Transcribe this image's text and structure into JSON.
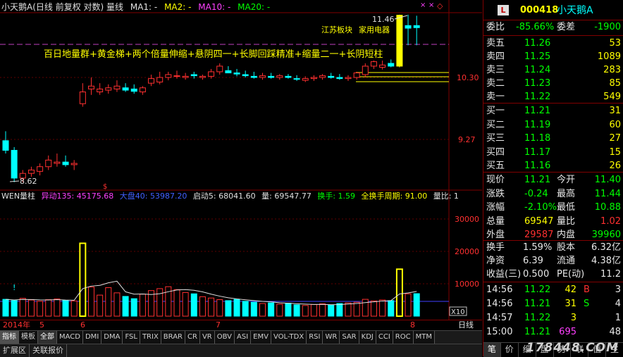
{
  "header": {
    "title": "小天鹅A(日线 前复权 对数) 量线",
    "ma1": "MA1: -",
    "ma2": "MA2: -",
    "ma10": "MA10: -",
    "ma20": "MA20: -"
  },
  "chart": {
    "high_label": "11.46",
    "low_label": "8.62",
    "sector1": "江苏板块",
    "sector2": "家用电器",
    "annotation": "百日地量群+黄金梯+两个倍量伸缩+悬阴四一+长脚回踩精准+缩量二一+长阴短柱",
    "price_axis": [
      "10.30",
      "9.27"
    ],
    "vol_axis": [
      "30000",
      "20000",
      "10000"
    ],
    "vol_unit": "X10",
    "event_mark": "$"
  },
  "volume_legend": {
    "name": "WEN量柱",
    "yidong": "异动135: 45175.68",
    "dapan": "大盘40: 53987.20",
    "qidong": "启动5: 68041.60",
    "liang": "量: 69547.77",
    "huanshou": "换手: 1.59",
    "quanhuanshou": "全换手周期: 91.00",
    "liangbi": "量比: 1"
  },
  "months": {
    "year": "2014年",
    "m5": "5",
    "m6": "6",
    "m7": "7",
    "m8": "8",
    "period": "日线"
  },
  "indicator_tabs": [
    "指标",
    "模板",
    "全部",
    "MACD",
    "DMI",
    "DMA",
    "FSL",
    "TRIX",
    "BRAR",
    "CR",
    "VR",
    "OBV",
    "ASI",
    "EMV",
    "VOL-TDX",
    "RSI",
    "WR",
    "SAR",
    "KDJ",
    "CCI",
    "ROC",
    "MTM"
  ],
  "bottom_tabs": [
    "扩展区",
    "关联报价"
  ],
  "quote": {
    "badge": "L",
    "code": "000418",
    "name": "小天鹅A",
    "weibi_label": "委比",
    "weibi_value": "-85.66%",
    "weicha_label": "委差",
    "weicha_value": "-1900",
    "asks": [
      {
        "label": "卖五",
        "price": "11.26",
        "vol": "53"
      },
      {
        "label": "卖四",
        "price": "11.25",
        "vol": "1089"
      },
      {
        "label": "卖三",
        "price": "11.24",
        "vol": "283"
      },
      {
        "label": "卖二",
        "price": "11.23",
        "vol": "85"
      },
      {
        "label": "卖一",
        "price": "11.22",
        "vol": "549"
      }
    ],
    "bids": [
      {
        "label": "买一",
        "price": "11.21",
        "vol": "31"
      },
      {
        "label": "买二",
        "price": "11.19",
        "vol": "60"
      },
      {
        "label": "买三",
        "price": "11.18",
        "vol": "27"
      },
      {
        "label": "买四",
        "price": "11.17",
        "vol": "15"
      },
      {
        "label": "买五",
        "price": "11.16",
        "vol": "26"
      }
    ],
    "stats": [
      {
        "l1": "现价",
        "v1": "11.21",
        "c1": "grn",
        "l2": "今开",
        "v2": "11.40",
        "c2": "grn"
      },
      {
        "l1": "涨跌",
        "v1": "-0.24",
        "c1": "grn",
        "l2": "最高",
        "v2": "11.44",
        "c2": "grn"
      },
      {
        "l1": "涨幅",
        "v1": "-2.10%",
        "c1": "grn",
        "l2": "最低",
        "v2": "10.88",
        "c2": "grn"
      },
      {
        "l1": "总量",
        "v1": "69547",
        "c1": "yel",
        "l2": "量比",
        "v2": "1.02",
        "c2": "red"
      },
      {
        "l1": "外盘",
        "v1": "29587",
        "c1": "red",
        "l2": "内盘",
        "v2": "39960",
        "c2": "grn"
      }
    ],
    "stats2": [
      {
        "l1": "换手",
        "v1": "1.59%",
        "l2": "股本",
        "v2": "6.32亿"
      },
      {
        "l1": "净资",
        "v1": "6.39",
        "l2": "流通",
        "v2": "4.38亿"
      },
      {
        "l1": "收益(三)",
        "v1": "0.500",
        "l2": "PE(动)",
        "v2": "11.2"
      }
    ],
    "ticks": [
      {
        "time": "14:56",
        "price": "11.22",
        "vol": "42",
        "dir": "B",
        "n": "3",
        "vc": "yel",
        "dc": "red"
      },
      {
        "time": "14:56",
        "price": "11.21",
        "vol": "31",
        "dir": "S",
        "n": "4",
        "vc": "yel",
        "dc": "grn"
      },
      {
        "time": "14:57",
        "price": "11.22",
        "vol": "3",
        "dir": "",
        "n": "1",
        "vc": "yel",
        "dc": "wht"
      },
      {
        "time": "15:00",
        "price": "11.21",
        "vol": "695",
        "dir": "",
        "n": "48",
        "vc": "mag",
        "dc": "wht"
      }
    ],
    "tabs": [
      "笔",
      "价",
      "细",
      "盘",
      "势",
      "联",
      "值",
      "主"
    ]
  },
  "watermark": "178448.COM",
  "chart_data": {
    "type": "candlestick",
    "x": [
      1,
      2,
      3,
      4,
      5,
      6,
      7,
      8,
      9,
      10,
      11,
      12,
      13,
      14,
      15,
      16,
      17,
      18,
      19,
      20,
      21,
      22,
      23,
      24,
      25,
      26,
      27,
      28,
      29,
      30,
      31,
      32,
      33,
      34,
      35,
      36,
      37,
      38,
      39,
      40,
      41,
      42,
      43,
      44,
      45,
      46,
      47,
      48,
      49
    ],
    "open": [
      9.25,
      9.1,
      8.68,
      8.75,
      8.78,
      8.85,
      8.9,
      8.92,
      8.88,
      9.85,
      10.1,
      10.05,
      10.08,
      10.1,
      10.12,
      10.1,
      10.05,
      10.2,
      10.22,
      10.3,
      10.32,
      10.3,
      10.35,
      10.3,
      10.32,
      10.4,
      10.42,
      10.38,
      10.35,
      10.32,
      10.3,
      10.32,
      10.3,
      10.32,
      10.28,
      10.25,
      10.28,
      10.3,
      10.32,
      10.3,
      10.28,
      10.3,
      10.35,
      10.5,
      10.48,
      10.55,
      10.5,
      11.2,
      11.25
    ],
    "high": [
      9.4,
      9.15,
      8.8,
      8.85,
      8.9,
      9.02,
      9.05,
      9.02,
      8.95,
      10.2,
      10.3,
      10.2,
      10.18,
      10.25,
      10.2,
      10.18,
      10.15,
      10.35,
      10.4,
      10.4,
      10.42,
      10.38,
      10.4,
      10.35,
      10.45,
      10.55,
      10.5,
      10.45,
      10.42,
      10.4,
      10.38,
      10.38,
      10.36,
      10.36,
      10.34,
      10.32,
      10.34,
      10.36,
      10.38,
      10.36,
      10.34,
      10.4,
      10.55,
      10.6,
      10.6,
      10.62,
      11.46,
      11.46,
      11.44
    ],
    "low": [
      9.05,
      8.62,
      8.62,
      8.7,
      8.72,
      8.8,
      8.85,
      8.85,
      8.8,
      9.8,
      10.0,
      10.0,
      10.02,
      10.05,
      10.05,
      10.02,
      10.0,
      10.15,
      10.18,
      10.25,
      10.28,
      10.26,
      10.28,
      10.26,
      10.28,
      10.35,
      10.38,
      10.32,
      10.3,
      10.28,
      10.26,
      10.28,
      10.26,
      10.28,
      10.24,
      10.22,
      10.24,
      10.26,
      10.28,
      10.26,
      10.24,
      10.26,
      10.3,
      10.45,
      10.44,
      10.48,
      10.48,
      10.88,
      10.88
    ],
    "close": [
      9.1,
      8.68,
      8.75,
      8.8,
      8.85,
      8.95,
      8.92,
      8.88,
      8.9,
      10.05,
      10.15,
      10.1,
      10.12,
      10.15,
      10.08,
      10.06,
      10.12,
      10.28,
      10.3,
      10.35,
      10.33,
      10.32,
      10.33,
      10.32,
      10.4,
      10.5,
      10.38,
      10.36,
      10.33,
      10.3,
      10.33,
      10.3,
      10.33,
      10.3,
      10.27,
      10.28,
      10.3,
      10.33,
      10.3,
      10.28,
      10.3,
      10.38,
      10.5,
      10.58,
      10.52,
      10.5,
      11.45,
      11.25,
      11.21
    ],
    "volume": [
      5200,
      4800,
      5500,
      5000,
      4600,
      5100,
      5300,
      4900,
      4700,
      22500,
      9000,
      6500,
      8800,
      7200,
      6100,
      5400,
      6800,
      7900,
      8500,
      9100,
      8200,
      7300,
      6900,
      6000,
      5600,
      5100,
      4800,
      5200,
      4600,
      4300,
      3900,
      4100,
      3700,
      4000,
      3500,
      3300,
      3600,
      3800,
      3400,
      3900,
      4100,
      4300,
      5200,
      4700,
      5000,
      4800,
      14500,
      6900,
      6955
    ],
    "price_ticks": [
      "10.30",
      "9.27"
    ],
    "volume_ticks": [
      "30000",
      "20000",
      "10000"
    ],
    "ylim_volume": [
      0,
      35000
    ]
  }
}
